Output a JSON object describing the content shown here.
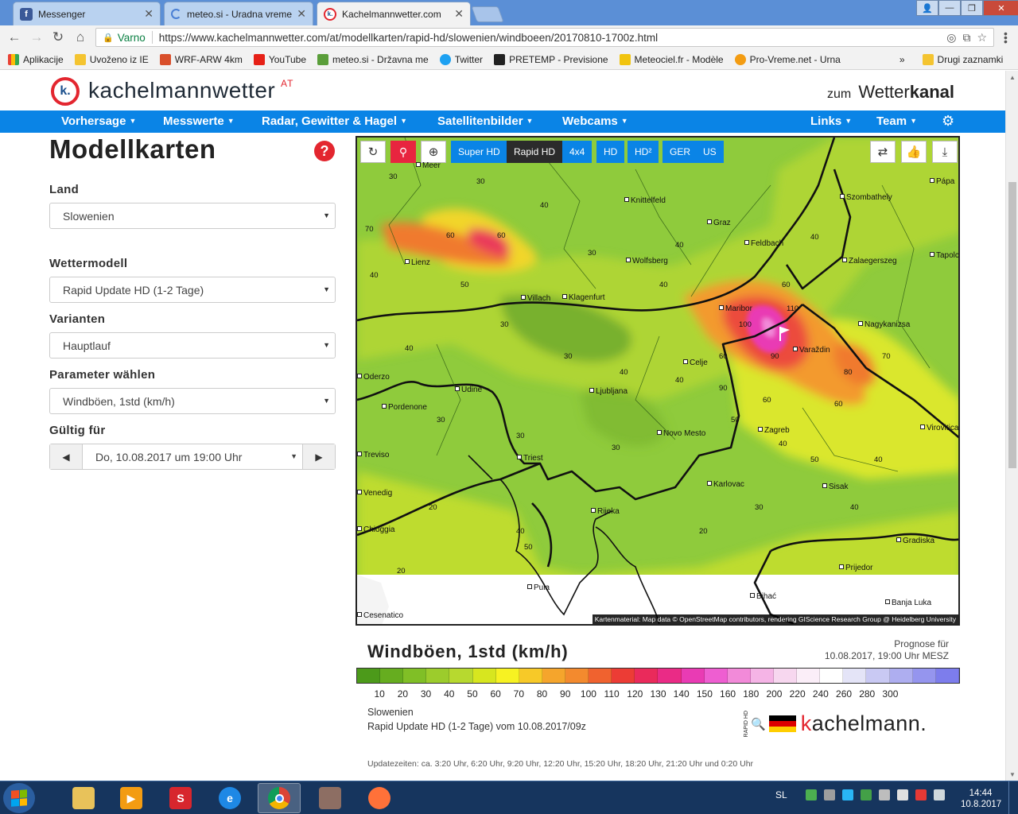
{
  "browser": {
    "tabs": [
      {
        "title": "Messenger",
        "icon": "facebook-icon",
        "color": "#3b5998"
      },
      {
        "title": "meteo.si - Uradna vreme",
        "icon": "loading-icon",
        "color": "#4a7fd4"
      },
      {
        "title": "Kachelmannwetter.com",
        "icon": "kachelmann-icon",
        "color": "#e3262f"
      }
    ],
    "window_user_icon": "user-icon",
    "secure_label": "Varno",
    "url": "https://www.kachelmannwetter.com/at/modellkarten/rapid-hd/slowenien/windboeen/20170810-1700z.html",
    "bookmarks": [
      {
        "label": "Aplikacije",
        "color": "#e94235"
      },
      {
        "label": "Uvoženo iz IE",
        "color": "#f4c430"
      },
      {
        "label": "WRF-ARW 4km",
        "color": "#d94f2b"
      },
      {
        "label": "YouTube",
        "color": "#e62117"
      },
      {
        "label": "meteo.si - Državna me",
        "color": "#5a9e3a"
      },
      {
        "label": "Twitter",
        "color": "#1da1f2"
      },
      {
        "label": "PRETEMP - Previsione",
        "color": "#222222"
      },
      {
        "label": "Meteociel.fr - Modèle",
        "color": "#f1c40f"
      },
      {
        "label": "Pro-Vreme.net - Urna",
        "color": "#f39c12"
      }
    ],
    "bookmarks_more": "»",
    "other_bookmarks": "Drugi zaznamki"
  },
  "site": {
    "logo_text": "kachelmannwetter",
    "logo_suffix": "AT",
    "logo_mark": "k.",
    "wetterkanal_prefix": "zum",
    "wetterkanal_a": "Wetter",
    "wetterkanal_b": "kanal",
    "nav": [
      "Vorhersage",
      "Messwerte",
      "Radar, Gewitter & Hagel",
      "Satellitenbilder",
      "Webcams"
    ],
    "nav_right": [
      "Links",
      "Team"
    ],
    "accent": "#0a84e6",
    "brand_red": "#e3262f"
  },
  "sidebar": {
    "title": "Modellkarten",
    "land_label": "Land",
    "land_value": "Slowenien",
    "model_label": "Wettermodell",
    "model_value": "Rapid Update HD (1-2 Tage)",
    "variant_label": "Varianten",
    "variant_value": "Hauptlauf",
    "param_label": "Parameter wählen",
    "param_value": "Windböen, 1std (km/h)",
    "valid_label": "Gültig für",
    "valid_value": "Do, 10.08.2017 um 19:00 Uhr"
  },
  "map": {
    "buttons": [
      "Super HD",
      "Rapid HD",
      "4x4",
      "HD",
      "HD²",
      "GER",
      "US"
    ],
    "active_button": "Rapid HD",
    "cities": [
      "Meer",
      "Knittelfeld",
      "Graz",
      "Szombathely",
      "Pápa",
      "Lienz",
      "Wolfsberg",
      "Feldbach",
      "Zalaegerszeg",
      "Tapolca",
      "Villach",
      "Klagenfurt",
      "Maribor",
      "Nagykanizsa",
      "Varaždin",
      "Celje",
      "Udine",
      "Ljubljana",
      "Pordenone",
      "Novo Mesto",
      "Zagreb",
      "Virovitica",
      "Triest",
      "Karlovac",
      "Sisak",
      "Venedig",
      "Rijeka",
      "Chioggia",
      "Gradiska",
      "Prijedor",
      "Pula",
      "Bihać",
      "Banja Luka",
      "Oderzo",
      "Treviso",
      "Cesenatico"
    ],
    "attribution": "Kartenmaterial: Map data © OpenStreetMap contributors, rendering GIScience Research Group @ Heidelberg University"
  },
  "legend": {
    "title": "Windböen, 1std (km/h)",
    "prognose_label": "Prognose für",
    "prognose_value": "10.08.2017, 19:00 Uhr MESZ",
    "ticks": [
      "10",
      "20",
      "30",
      "40",
      "50",
      "60",
      "70",
      "80",
      "90",
      "100",
      "110",
      "120",
      "130",
      "140",
      "150",
      "160",
      "180",
      "200",
      "220",
      "240",
      "260",
      "280",
      "300"
    ],
    "colors": [
      "#4c9a1a",
      "#66ad1f",
      "#80bf26",
      "#9ccc2c",
      "#b7d92f",
      "#d7e61f",
      "#f7f222",
      "#f7c928",
      "#f5a52c",
      "#f38a2e",
      "#f0622f",
      "#ec3c35",
      "#ea2a5b",
      "#ea2b86",
      "#e93bb4",
      "#ee5ed1",
      "#f28ad9",
      "#f5b4e6",
      "#f7d7ef",
      "#fbeef8",
      "#ffffff",
      "#e4e4f7",
      "#c9c9f3",
      "#aeaef0",
      "#9595ee",
      "#7d7dec"
    ],
    "region": "Slowenien",
    "run": "Rapid Update HD (1-2 Tage) vom 10.08.2017/09z",
    "brand": "kachelmann.",
    "brand_tag": "RAPID HD",
    "updates": "Updatezeiten: ca. 3:20 Uhr, 6:20 Uhr, 9:20 Uhr, 12:20 Uhr, 15:20 Uhr, 18:20 Uhr, 21:20 Uhr und 0:20 Uhr"
  },
  "taskbar": {
    "apps": [
      "explorer-icon",
      "media-player-icon",
      "snagit-icon",
      "internet-explorer-icon",
      "chrome-icon",
      "game-icon",
      "firefox-icon"
    ],
    "lang": "SL",
    "time": "14:44",
    "date": "10.8.2017"
  }
}
